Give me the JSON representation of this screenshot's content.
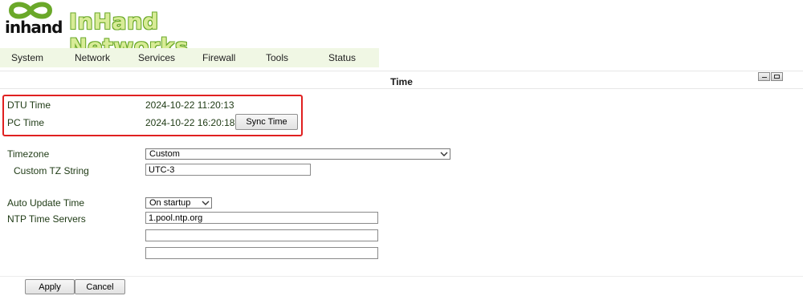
{
  "logo": {
    "word": "inhand",
    "brand": "InHand Networks"
  },
  "menu": [
    "System",
    "Network",
    "Services",
    "Firewall",
    "Tools",
    "Status"
  ],
  "section": {
    "title": "Time"
  },
  "time": {
    "dtu_label": "DTU Time",
    "dtu_value": "2024-10-22 11:20:13",
    "pc_label": "PC Time",
    "pc_value": "2024-10-22 16:20:18",
    "sync_button": "Sync Time"
  },
  "timezone": {
    "label": "Timezone",
    "selected": "Custom",
    "custom_label": "Custom TZ String",
    "custom_value": "UTC-3"
  },
  "update": {
    "label": "Auto Update Time",
    "selected": "On startup"
  },
  "ntp": {
    "label": "NTP Time Servers",
    "servers": [
      "1.pool.ntp.org",
      "",
      ""
    ]
  },
  "actions": {
    "apply": "Apply",
    "cancel": "Cancel"
  },
  "colors": {
    "menu_bg": "#f0f7e4",
    "label_text": "#1e3a14",
    "highlight_border": "#e02020",
    "brand_green": "#6aa829"
  }
}
